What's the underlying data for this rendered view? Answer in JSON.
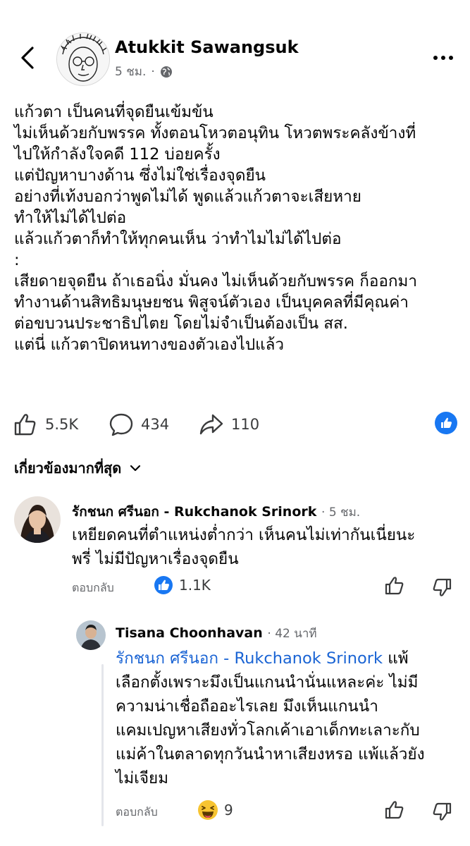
{
  "header": {
    "back_icon": "chevron-left-icon",
    "author_name": "Atukkit Sawangsuk",
    "time": "5 ชม.",
    "separator": "·",
    "privacy_icon": "globe-icon",
    "more_icon": "more-dots-icon"
  },
  "post": {
    "lines": [
      "แก้วตา เป็นคนที่จุดยืนเข้มข้น",
      "ไม่เห็นด้วยกับพรรค ทั้งตอนโหวตอนุทิน โหวตพระคลังข้างที่",
      "ไปให้กำลังใจคดี 112 บ่อยครั้ง",
      "แต่ปัญหาบางด้าน ซึ่งไม่ใช่เรื่องจุดยืน",
      "อย่างที่เท้งบอกว่าพูดไม่ได้ พูดแล้วแก้วตาจะเสียหาย",
      "ทำให้ไม่ได้ไปต่อ",
      "แล้วแก้วตาก็ทำให้ทุกคนเห็น ว่าทำไมไม่ได้ไปต่อ",
      ":",
      "เสียดายจุดยืน ถ้าเธอนิ่ง มั่นคง ไม่เห็นด้วยกับพรรค ก็ออกมา",
      "ทำงานด้านสิทธิมนุษยชน พิสูจน์ตัวเอง เป็นบุคคลที่มีคุณค่า",
      "ต่อขบวนประชาธิปไตย โดยไม่จำเป็นต้องเป็น สส.",
      "แต่นี่ แก้วตาปิดหนทางของตัวเองไปแล้ว"
    ]
  },
  "stats": {
    "likes": "5.5K",
    "comments": "434",
    "shares": "110"
  },
  "comments_sort": {
    "label": "เกี่ยวข้องมากที่สุด"
  },
  "comments": [
    {
      "author": "รักชนก ศรีนอก - Rukchanok Srinork",
      "time": "5 ชม.",
      "lines": [
        "เหยียดคนที่ตำแหน่งต่ำกว่า เห็นคนไม่เท่ากันเนี่ยนะ",
        "พรี่ ไม่มีปัญหาเรื่องจุดยืน"
      ],
      "reply_label": "ตอบกลับ",
      "reaction_count": "1.1K",
      "reaction_icon": "like-reaction-icon"
    },
    {
      "author": "Tisana Choonhavan",
      "time": "42 นาที",
      "mention": "รักชนก ศรีนอก - Rukchanok Srinork",
      "first_line_rest": "แพ้",
      "lines": [
        "เลือกตั้งเพราะมึงเป็นแกนนำนั่นแหละค่ะ ไม่มี",
        "ความน่าเชื่อถืออะไรเลย มึงเห็นแกนนำ",
        "แคมเปญหาเสียงทั่วโลกเค้าเอาเด็กทะเลาะกับ",
        "แม่ค้าในตลาดทุกวันนำหาเสียงหรอ แพ้แล้วยัง",
        "ไม่เจียม"
      ],
      "reply_label": "ตอบกลับ",
      "reaction_count": "9",
      "reaction_icon": "haha-reaction-icon"
    }
  ],
  "colors": {
    "accent": "#1877f2",
    "mention": "#1a64d4",
    "secondary_text": "#65676b"
  }
}
